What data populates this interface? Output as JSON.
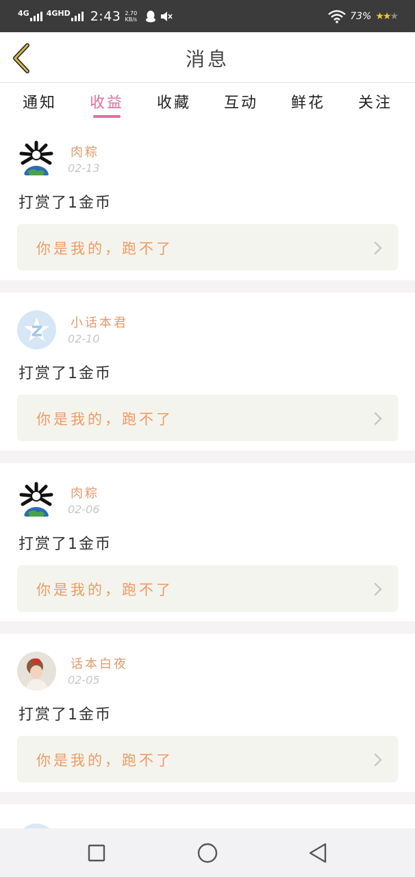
{
  "status_bar": {
    "sig1": "4G",
    "sig2": "4GHD",
    "time": "2:43",
    "net_speed": "2.70",
    "net_unit": "KB/s",
    "battery": "73%"
  },
  "header": {
    "title": "消息"
  },
  "tabs": [
    {
      "label": "通知"
    },
    {
      "label": "收益"
    },
    {
      "label": "收藏"
    },
    {
      "label": "互动"
    },
    {
      "label": "鲜花"
    },
    {
      "label": "关注"
    }
  ],
  "active_tab": "收益",
  "messages": [
    {
      "name": "肉粽",
      "date": "02-13",
      "action": "打赏了1金币",
      "quote": "你是我的，跑不了",
      "avatar": "globe-flower-avatar"
    },
    {
      "name": "小话本君",
      "date": "02-10",
      "action": "打赏了1金币",
      "quote": "你是我的，跑不了",
      "avatar": "default-z-avatar"
    },
    {
      "name": "肉粽",
      "date": "02-06",
      "action": "打赏了1金币",
      "quote": "你是我的，跑不了",
      "avatar": "globe-flower-avatar"
    },
    {
      "name": "话本白夜",
      "date": "02-05",
      "action": "打赏了1金币",
      "quote": "你是我的，跑不了",
      "avatar": "girl-photo-avatar"
    }
  ],
  "colors": {
    "accent": "#de6fa4",
    "name": "#e39a6c",
    "quote_text": "#ef9a63",
    "quote_bg": "#f4f4ee",
    "status_bar": "#3b3b3b",
    "back_arrow": "#d6b84a"
  },
  "icons": {
    "back": "chevron-left-icon",
    "quote_arrow": "chevron-right-icon",
    "nav": [
      "square-icon",
      "circle-icon",
      "triangle-back-icon"
    ]
  }
}
